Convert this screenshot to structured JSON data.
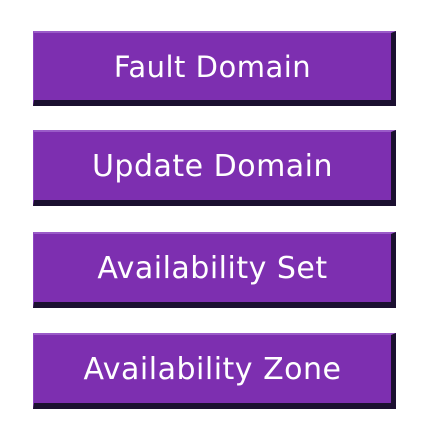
{
  "boxes": [
    {
      "label": "Fault Domain"
    },
    {
      "label": "Update Domain"
    },
    {
      "label": "Availability Set"
    },
    {
      "label": "Availability Zone"
    }
  ],
  "colors": {
    "box_fill": "#7d2fb0",
    "box_shadow": "#1b1030",
    "text": "#ffffff",
    "background": "#ffffff"
  }
}
